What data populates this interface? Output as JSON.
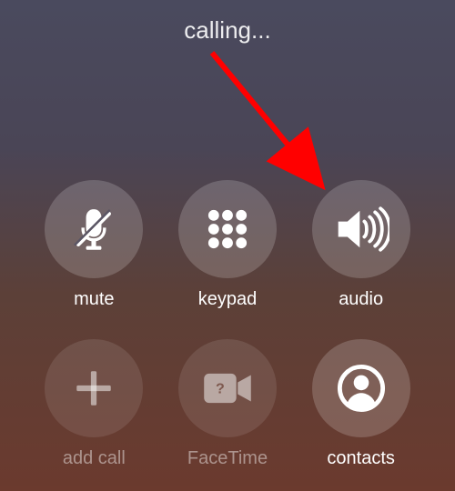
{
  "status": "calling...",
  "buttons": {
    "mute": {
      "label": "mute",
      "enabled": true
    },
    "keypad": {
      "label": "keypad",
      "enabled": true
    },
    "audio": {
      "label": "audio",
      "enabled": true
    },
    "add_call": {
      "label": "add call",
      "enabled": false
    },
    "facetime": {
      "label": "FaceTime",
      "enabled": false
    },
    "contacts": {
      "label": "contacts",
      "enabled": true
    }
  },
  "annotation": {
    "arrow_color": "#ff0000",
    "target": "audio"
  }
}
